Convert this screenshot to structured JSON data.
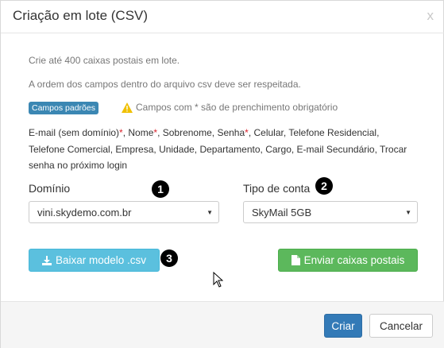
{
  "modal": {
    "title": "Criação em lote (CSV)",
    "close_label": "x"
  },
  "body": {
    "line1": "Crie até 400 caixas postais em lote.",
    "line2": "A ordem dos campos dentro do arquivo csv deve ser respeitada.",
    "badge": "Campos padrões",
    "warning": "Campos com * são de prenchimento obrigatório",
    "fields": [
      {
        "name": "E-mail (sem domínio)",
        "required": true
      },
      {
        "name": "Nome",
        "required": true
      },
      {
        "name": "Sobrenome",
        "required": false
      },
      {
        "name": "Senha",
        "required": true
      },
      {
        "name": "Celular",
        "required": false
      },
      {
        "name": "Telefone Residencial",
        "required": false
      },
      {
        "name": "Telefone Comercial",
        "required": false
      },
      {
        "name": "Empresa",
        "required": false
      },
      {
        "name": "Unidade",
        "required": false
      },
      {
        "name": "Departamento",
        "required": false
      },
      {
        "name": "Cargo",
        "required": false
      },
      {
        "name": "E-mail Secundário",
        "required": false
      },
      {
        "name": "Trocar senha no próximo login",
        "required": false
      }
    ]
  },
  "form": {
    "dominio_label": "Domínio",
    "dominio_value": "vini.skydemo.com.br",
    "tipo_label": "Tipo de conta",
    "tipo_value": "SkyMail 5GB"
  },
  "markers": [
    "1",
    "2",
    "3"
  ],
  "buttons": {
    "baixar": "Baixar modelo .csv",
    "enviar": "Enviar caixas postais",
    "criar": "Criar",
    "cancelar": "Cancelar"
  },
  "colors": {
    "primary": "#337ab7",
    "info": "#5bc0de",
    "success": "#5cb85c",
    "badge": "#3b87b3",
    "required": "#d9232d",
    "warning_icon": "#f0c000"
  },
  "icons": {
    "warning": "warning-triangle-icon",
    "download": "download-icon",
    "file": "file-icon"
  }
}
